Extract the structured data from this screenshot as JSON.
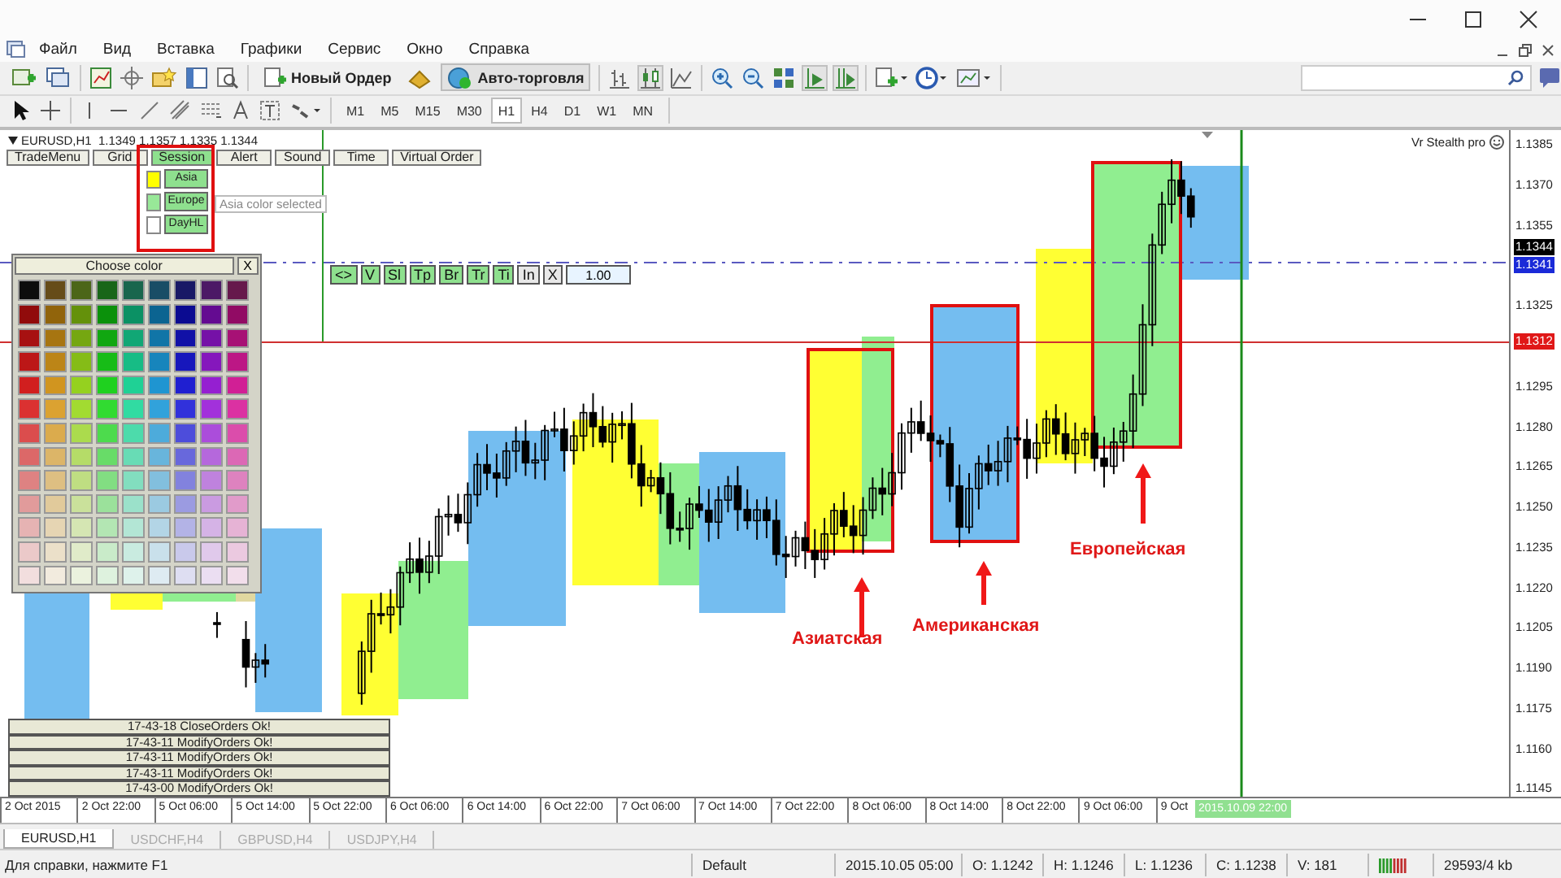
{
  "menu": [
    "Файл",
    "Вид",
    "Вставка",
    "Графики",
    "Сервис",
    "Окно",
    "Справка"
  ],
  "toolbar": {
    "new_order": "Новый Ордер",
    "auto_trading": {
      "label": "Авто-торговля",
      "selected": true
    }
  },
  "timeframes": [
    {
      "label": "M1",
      "selected": false
    },
    {
      "label": "M5",
      "selected": false
    },
    {
      "label": "M15",
      "selected": false
    },
    {
      "label": "M30",
      "selected": false
    },
    {
      "label": "H1",
      "selected": true
    },
    {
      "label": "H4",
      "selected": false
    },
    {
      "label": "D1",
      "selected": false
    },
    {
      "label": "W1",
      "selected": false
    },
    {
      "label": "MN",
      "selected": false
    }
  ],
  "chart": {
    "header": "EURUSD,H1  1.1349 1.1357 1.1335 1.1344",
    "indicator": "Vr Stealth pro",
    "panel_buttons": [
      {
        "label": "TradeMenu",
        "selected": false
      },
      {
        "label": "Grid",
        "selected": false
      },
      {
        "label": "Session",
        "selected": true
      },
      {
        "label": "Alert",
        "selected": false
      },
      {
        "label": "Sound",
        "selected": false
      },
      {
        "label": "Time",
        "selected": false
      },
      {
        "label": "Virtual Order",
        "selected": false
      }
    ],
    "session_items": [
      {
        "label": "Asia",
        "color": "#ffff00"
      },
      {
        "label": "Europe",
        "color": "#98e898"
      },
      {
        "label": "DayHL",
        "color": "#ffffff"
      }
    ],
    "tooltip": "Asia color selected",
    "order_buttons": [
      {
        "label": "<>",
        "active": true
      },
      {
        "label": "V",
        "active": true
      },
      {
        "label": "Sl",
        "active": true
      },
      {
        "label": "Tp",
        "active": true
      },
      {
        "label": "Br",
        "active": true
      },
      {
        "label": "Tr",
        "active": true
      },
      {
        "label": "Ti",
        "active": true
      },
      {
        "label": "In",
        "active": false
      },
      {
        "label": "X",
        "active": false
      }
    ],
    "lot": "1.00",
    "color_picker": {
      "title": "Choose color",
      "close": "X"
    },
    "log": [
      "17-43-18 CloseOrders Ok!",
      "17-43-11 ModifyOrders Ok!",
      "17-43-11 ModifyOrders Ok!",
      "17-43-11 ModifyOrders Ok!",
      "17-43-00 ModifyOrders Ok!"
    ],
    "annotations": [
      "Азиатская",
      "Американская",
      "Европейская"
    ],
    "price_labels": [
      {
        "text": "1.1385",
        "kind": "tick"
      },
      {
        "text": "1.1370",
        "kind": "tick"
      },
      {
        "text": "1.1355",
        "kind": "tick"
      },
      {
        "text": "1.1344",
        "kind": "bid"
      },
      {
        "text": "1.1341",
        "kind": "line"
      },
      {
        "text": "1.1325",
        "kind": "tick"
      },
      {
        "text": "1.1312",
        "kind": "level"
      },
      {
        "text": "1.1295",
        "kind": "tick"
      },
      {
        "text": "1.1280",
        "kind": "tick"
      },
      {
        "text": "1.1265",
        "kind": "tick"
      },
      {
        "text": "1.1250",
        "kind": "tick"
      },
      {
        "text": "1.1235",
        "kind": "tick"
      },
      {
        "text": "1.1220",
        "kind": "tick"
      },
      {
        "text": "1.1205",
        "kind": "tick"
      },
      {
        "text": "1.1190",
        "kind": "tick"
      },
      {
        "text": "1.1175",
        "kind": "tick"
      },
      {
        "text": "1.1160",
        "kind": "tick"
      },
      {
        "text": "1.1145",
        "kind": "tick"
      }
    ],
    "time_labels": [
      "2 Oct 2015",
      "2 Oct 22:00",
      "5 Oct 06:00",
      "5 Oct 14:00",
      "5 Oct 22:00",
      "6 Oct 06:00",
      "6 Oct 14:00",
      "6 Oct 22:00",
      "7 Oct 06:00",
      "7 Oct 14:00",
      "7 Oct 22:00",
      "8 Oct 06:00",
      "8 Oct 14:00",
      "8 Oct 22:00",
      "9 Oct 06:00",
      "9 Oct"
    ],
    "cursor_time": "2015.10.09 22:00"
  },
  "tabs": [
    {
      "label": "EURUSD,H1",
      "selected": true
    },
    {
      "label": "USDCHF,H4",
      "selected": false
    },
    {
      "label": "GBPUSD,H4",
      "selected": false
    },
    {
      "label": "USDJPY,H4",
      "selected": false
    }
  ],
  "status_bar": {
    "help": "Для справки, нажмите F1",
    "profile": "Default",
    "time": "2015.10.05 05:00",
    "open": "O: 1.1242",
    "high": "H: 1.1246",
    "low": "L: 1.1236",
    "close": "C: 1.1238",
    "volume": "V: 181",
    "traffic": "29593/4 kb"
  }
}
